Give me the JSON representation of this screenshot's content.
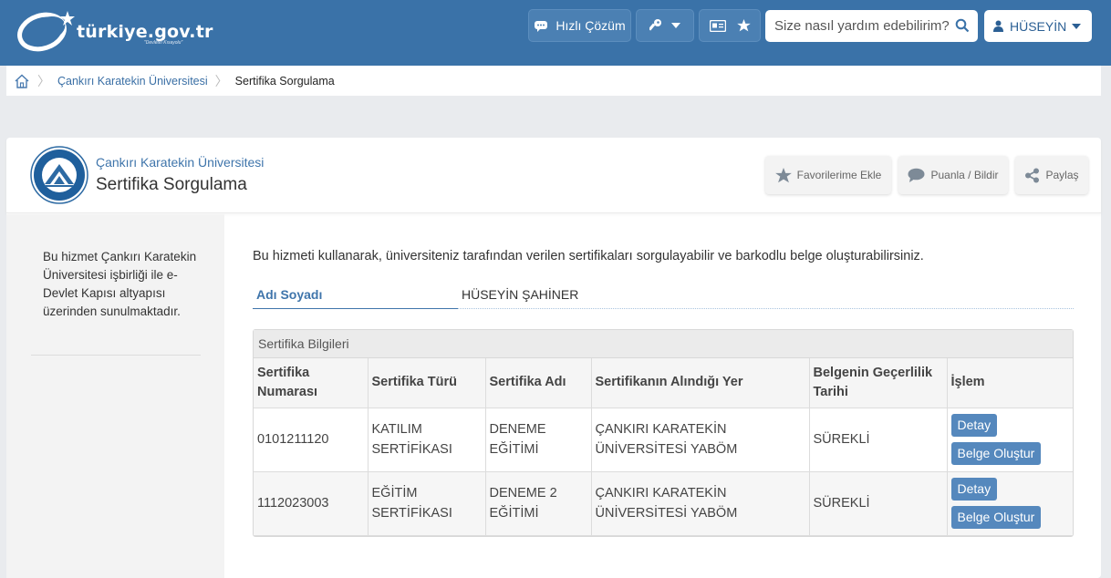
{
  "header": {
    "logo_text": "türkiye.gov.tr",
    "logo_tagline": "\"Devletin Kısayolu\"",
    "quick_solution_label": "Hızlı Çözüm",
    "search_placeholder": "Size nasıl yardım edebilirim?",
    "user_name": "HÜSEYİN",
    "icons": [
      "chat-icon",
      "key-icon",
      "chevron-down-icon",
      "id-card-icon",
      "star-icon",
      "search-icon",
      "user-icon"
    ]
  },
  "breadcrumb": {
    "items": [
      "Çankırı Karatekin Üniversitesi",
      "Sertifika Sorgulama"
    ]
  },
  "service": {
    "organization": "Çankırı Karatekin Üniversitesi",
    "title": "Sertifika Sorgulama",
    "actions": {
      "favorite": "Favorilerime Ekle",
      "rate": "Puanla / Bildir",
      "share": "Paylaş"
    }
  },
  "sidebar": {
    "text": "Bu hizmet Çankırı Karatekin Üniversitesi işbirliği ile e-Devlet Kapısı altyapısı üzerinden sunulmaktadır."
  },
  "main": {
    "description": "Bu hizmeti kullanarak, üniversiteniz tarafından verilen sertifikaları sorgulayabilir ve barkodlu belge oluşturabilirsiniz.",
    "name_label": "Adı Soyadı",
    "name_value": "HÜSEYİN ŞAHİNER",
    "table": {
      "caption": "Sertifika Bilgileri",
      "headers": [
        "Sertifika Numarası",
        "Sertifika Türü",
        "Sertifika Adı",
        "Sertifikanın Alındığı Yer",
        "Belgenin Geçerlilik Tarihi",
        "İşlem"
      ],
      "rows": [
        {
          "number": "0101211120",
          "type": "KATILIM SERTİFİKASI",
          "name": "DENEME EĞİTİMİ",
          "place": "ÇANKIRI KARATEKİN ÜNİVERSİTESİ YABÖM",
          "validity": "SÜREKLİ",
          "detail": "Detay",
          "create": "Belge Oluştur"
        },
        {
          "number": "1112023003",
          "type": "EĞİTİM SERTİFİKASI",
          "name": "DENEME 2 EĞİTİMİ",
          "place": "ÇANKIRI KARATEKİN ÜNİVERSİTESİ YABÖM",
          "validity": "SÜREKLİ",
          "detail": "Detay",
          "create": "Belge Oluştur"
        }
      ]
    }
  },
  "colors": {
    "header_bg": "#3a72a8",
    "link": "#3f75ab",
    "button": "#5588bd"
  }
}
